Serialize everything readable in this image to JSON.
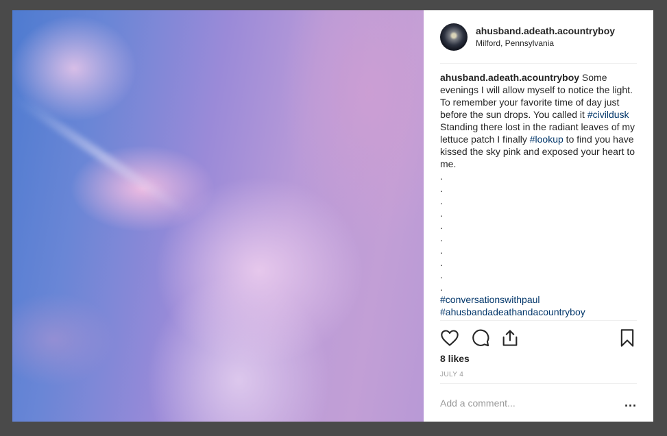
{
  "post": {
    "username": "ahusband.adeath.acountryboy",
    "location": "Milford, Pennsylvania",
    "photo_icon": "sky-photo"
  },
  "caption": {
    "user": "ahusband.adeath.acountryboy",
    "text1": " Some evenings I will allow myself to notice the light. To remember your favorite time of day just before the sun drops. You called it ",
    "tag1": "#civildusk",
    "text2": " Standing there lost in the radiant leaves of my lettuce patch I finally ",
    "tag2": "#lookup",
    "text3": " to find you have kissed the sky pink and exposed your heart to me.",
    "dots": [
      ".",
      ".",
      ".",
      ".",
      ".",
      ".",
      ".",
      ".",
      ".",
      "."
    ],
    "tag3": "#conversationswithpaul",
    "tag4": "#ahusbandadeathandacountryboy"
  },
  "actions": {
    "icons": [
      "heart-icon",
      "comment-icon",
      "share-icon",
      "bookmark-icon"
    ]
  },
  "likes": "8 likes",
  "date": "JULY 4",
  "comment": {
    "placeholder": "Add a comment...",
    "more": "..."
  }
}
